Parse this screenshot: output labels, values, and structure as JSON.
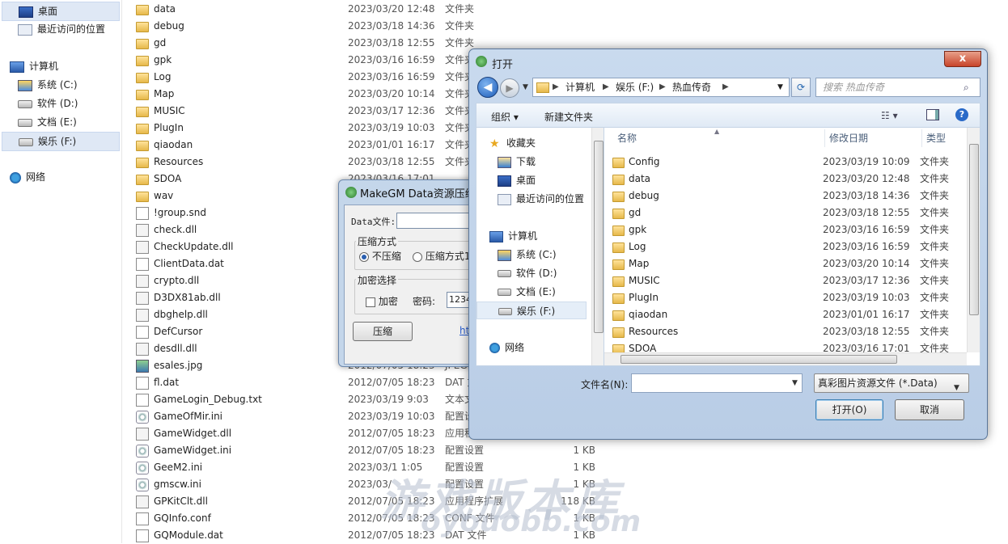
{
  "nav": {
    "items": [
      {
        "label": "桌面",
        "icon": "desktop-icon",
        "selected": true
      },
      {
        "label": "最近访问的位置",
        "icon": "recent-places-icon"
      },
      {
        "label": "计算机",
        "icon": "computer-icon"
      },
      {
        "label": "系统 (C:)",
        "icon": "system-drive-icon"
      },
      {
        "label": "软件 (D:)",
        "icon": "drive-icon"
      },
      {
        "label": "文档 (E:)",
        "icon": "drive-icon"
      },
      {
        "label": "娱乐 (F:)",
        "icon": "drive-icon",
        "selected": true
      },
      {
        "label": "网络",
        "icon": "network-icon"
      }
    ]
  },
  "files": [
    {
      "name": "data",
      "date": "2023/03/20 12:48",
      "type": "文件夹",
      "size": "",
      "icon": "folder"
    },
    {
      "name": "debug",
      "date": "2023/03/18 14:36",
      "type": "文件夹",
      "size": "",
      "icon": "folder"
    },
    {
      "name": "gd",
      "date": "2023/03/18 12:55",
      "type": "文件夹",
      "size": "",
      "icon": "folder"
    },
    {
      "name": "gpk",
      "date": "2023/03/16 16:59",
      "type": "文件夹",
      "size": "",
      "icon": "folder"
    },
    {
      "name": "Log",
      "date": "2023/03/16 16:59",
      "type": "文件夹",
      "size": "",
      "icon": "folder"
    },
    {
      "name": "Map",
      "date": "2023/03/20 10:14",
      "type": "文件夹",
      "size": "",
      "icon": "folder"
    },
    {
      "name": "MUSIC",
      "date": "2023/03/17 12:36",
      "type": "文件夹",
      "size": "",
      "icon": "folder"
    },
    {
      "name": "PlugIn",
      "date": "2023/03/19 10:03",
      "type": "文件夹",
      "size": "",
      "icon": "folder"
    },
    {
      "name": "qiaodan",
      "date": "2023/01/01 16:17",
      "type": "文件夹",
      "size": "",
      "icon": "folder"
    },
    {
      "name": "Resources",
      "date": "2023/03/18 12:55",
      "type": "文件夹",
      "size": "",
      "icon": "folder"
    },
    {
      "name": "SDOA",
      "date": "2023/03/16 17:01",
      "type": "",
      "size": "",
      "icon": "folder"
    },
    {
      "name": "wav",
      "date": "",
      "type": "",
      "size": "",
      "icon": "folder"
    },
    {
      "name": "!group.snd",
      "date": "",
      "type": "",
      "size": "",
      "icon": "file"
    },
    {
      "name": "check.dll",
      "date": "",
      "type": "",
      "size": "",
      "icon": "dll"
    },
    {
      "name": "CheckUpdate.dll",
      "date": "",
      "type": "",
      "size": "",
      "icon": "dll"
    },
    {
      "name": "ClientData.dat",
      "date": "",
      "type": "",
      "size": "",
      "icon": "file"
    },
    {
      "name": "crypto.dll",
      "date": "",
      "type": "",
      "size": "",
      "icon": "dll"
    },
    {
      "name": "D3DX81ab.dll",
      "date": "",
      "type": "",
      "size": "",
      "icon": "dll"
    },
    {
      "name": "dbghelp.dll",
      "date": "",
      "type": "",
      "size": "",
      "icon": "dll"
    },
    {
      "name": "DefCursor",
      "date": "",
      "type": "",
      "size": "",
      "icon": "file"
    },
    {
      "name": "desdll.dll",
      "date": "",
      "type": "",
      "size": "",
      "icon": "dll"
    },
    {
      "name": "esales.jpg",
      "date": "2012/07/05 18:23",
      "type": "JPEG",
      "size": "",
      "icon": "jpg"
    },
    {
      "name": "fl.dat",
      "date": "2012/07/05 18:23",
      "type": "DAT 文件",
      "size": "",
      "icon": "file"
    },
    {
      "name": "GameLogin_Debug.txt",
      "date": "2023/03/19 9:03",
      "type": "文本文",
      "size": "",
      "icon": "file"
    },
    {
      "name": "GameOfMir.ini",
      "date": "2023/03/19 10:03",
      "type": "配置设",
      "size": "",
      "icon": "gear"
    },
    {
      "name": "GameWidget.dll",
      "date": "2012/07/05 18:23",
      "type": "应用程",
      "size": "",
      "icon": "dll"
    },
    {
      "name": "GameWidget.ini",
      "date": "2012/07/05 18:23",
      "type": "配置设置",
      "size": "1 KB",
      "icon": "gear"
    },
    {
      "name": "GeeM2.ini",
      "date": "2023/03/1 1:05",
      "type": "配置设置",
      "size": "1 KB",
      "icon": "gear"
    },
    {
      "name": "gmscw.ini",
      "date": "2023/03/",
      "type": "配置设置",
      "size": "1 KB",
      "icon": "gear"
    },
    {
      "name": "GPKitClt.dll",
      "date": "2012/07/05 18:23",
      "type": "应用程序扩展",
      "size": "118 KB",
      "icon": "dll"
    },
    {
      "name": "GQInfo.conf",
      "date": "2012/07/05 18:23",
      "type": "CONF 文件",
      "size": "1 KB",
      "icon": "file"
    },
    {
      "name": "GQModule.dat",
      "date": "2012/07/05 18:23",
      "type": "DAT 文件",
      "size": "1 KB",
      "icon": "file"
    }
  ],
  "makegm": {
    "title": "MakeGM Data资源压缩",
    "data_file_label": "Data文件:",
    "compress_group": "压缩方式",
    "radio_none": "不压缩",
    "radio_mode1": "压缩方式1",
    "encrypt_group": "加密选择",
    "encrypt_check": "加密",
    "password_label": "密码:",
    "password_value": "1234",
    "compress_button": "压缩",
    "link_text": "ht"
  },
  "dialog": {
    "title": "打开",
    "close": "x",
    "breadcrumb": [
      "计算机",
      "娱乐 (F:)",
      "热血传奇"
    ],
    "search_placeholder": "搜索 热血传奇",
    "toolbar": {
      "organize": "组织 ▾",
      "new_folder": "新建文件夹"
    },
    "pane_items": [
      {
        "label": "收藏夹",
        "icon": "star-icon"
      },
      {
        "label": "下载",
        "icon": "download-icon"
      },
      {
        "label": "桌面",
        "icon": "desktop-icon"
      },
      {
        "label": "最近访问的位置",
        "icon": "recent-places-icon"
      },
      {
        "label": "计算机",
        "icon": "computer-icon"
      },
      {
        "label": "系统 (C:)",
        "icon": "system-drive-icon"
      },
      {
        "label": "软件 (D:)",
        "icon": "drive-icon"
      },
      {
        "label": "文档 (E:)",
        "icon": "drive-icon"
      },
      {
        "label": "娱乐 (F:)",
        "icon": "drive-icon",
        "selected": true
      },
      {
        "label": "网络",
        "icon": "network-icon"
      }
    ],
    "columns": {
      "name": "名称",
      "date": "修改日期",
      "type": "类型"
    },
    "rows": [
      {
        "name": "Config",
        "date": "2023/03/19 10:09",
        "type": "文件夹"
      },
      {
        "name": "data",
        "date": "2023/03/20 12:48",
        "type": "文件夹"
      },
      {
        "name": "debug",
        "date": "2023/03/18 14:36",
        "type": "文件夹"
      },
      {
        "name": "gd",
        "date": "2023/03/18 12:55",
        "type": "文件夹"
      },
      {
        "name": "gpk",
        "date": "2023/03/16 16:59",
        "type": "文件夹"
      },
      {
        "name": "Log",
        "date": "2023/03/16 16:59",
        "type": "文件夹"
      },
      {
        "name": "Map",
        "date": "2023/03/20 10:14",
        "type": "文件夹"
      },
      {
        "name": "MUSIC",
        "date": "2023/03/17 12:36",
        "type": "文件夹"
      },
      {
        "name": "PlugIn",
        "date": "2023/03/19 10:03",
        "type": "文件夹"
      },
      {
        "name": "qiaodan",
        "date": "2023/01/01 16:17",
        "type": "文件夹"
      },
      {
        "name": "Resources",
        "date": "2023/03/18 12:55",
        "type": "文件夹"
      },
      {
        "name": "SDOA",
        "date": "2023/03/16 17:01",
        "type": "文件夹"
      }
    ],
    "filename_label": "文件名(N):",
    "filename_value": "",
    "filetype_value": "真彩图片资源文件 (*.Data)",
    "open_button": "打开(O)",
    "cancel_button": "取消"
  },
  "watermark": "游戏版本库",
  "watermark_url": "oyouobb.com"
}
